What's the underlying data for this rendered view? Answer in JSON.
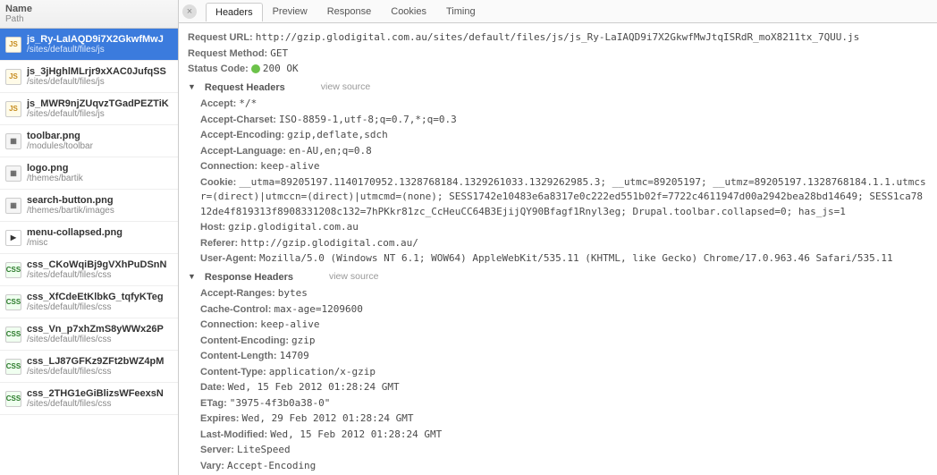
{
  "sidebar": {
    "header_name": "Name",
    "header_path": "Path",
    "items": [
      {
        "icon": "js",
        "name": "js_Ry-LaIAQD9i7X2GkwfMwJ",
        "path": "/sites/default/files/js",
        "selected": true
      },
      {
        "icon": "js",
        "name": "js_3jHghlMLrjr9xXAC0JufqSS",
        "path": "/sites/default/files/js"
      },
      {
        "icon": "js",
        "name": "js_MWR9njZUqvzTGadPEZTiK",
        "path": "/sites/default/files/js"
      },
      {
        "icon": "img",
        "name": "toolbar.png",
        "path": "/modules/toolbar"
      },
      {
        "icon": "img",
        "name": "logo.png",
        "path": "/themes/bartik"
      },
      {
        "icon": "img",
        "name": "search-button.png",
        "path": "/themes/bartik/images"
      },
      {
        "icon": "play",
        "name": "menu-collapsed.png",
        "path": "/misc"
      },
      {
        "icon": "css",
        "name": "css_CKoWqiBj9gVXhPuDSnN",
        "path": "/sites/default/files/css"
      },
      {
        "icon": "css",
        "name": "css_XfCdeEtKlbkG_tqfyKTeg",
        "path": "/sites/default/files/css"
      },
      {
        "icon": "css",
        "name": "css_Vn_p7xhZmS8yWWx26P",
        "path": "/sites/default/files/css"
      },
      {
        "icon": "css",
        "name": "css_LJ87GFKz9ZFt2bWZ4pM",
        "path": "/sites/default/files/css"
      },
      {
        "icon": "css",
        "name": "css_2THG1eGiBlizsWFeexsN",
        "path": "/sites/default/files/css"
      }
    ]
  },
  "tabs": [
    "Headers",
    "Preview",
    "Response",
    "Cookies",
    "Timing"
  ],
  "active_tab": 0,
  "general": {
    "request_url_label": "Request URL:",
    "request_url": "http://gzip.glodigital.com.au/sites/default/files/js/js_Ry-LaIAQD9i7X2GkwfMwJtqISRdR_moX8211tx_7QUU.js",
    "request_method_label": "Request Method:",
    "request_method": "GET",
    "status_code_label": "Status Code:",
    "status_code": "200 OK"
  },
  "request_headers_title": "Request Headers",
  "response_headers_title": "Response Headers",
  "view_source_label": "view source",
  "request_headers": [
    {
      "k": "Accept:",
      "v": "*/*"
    },
    {
      "k": "Accept-Charset:",
      "v": "ISO-8859-1,utf-8;q=0.7,*;q=0.3"
    },
    {
      "k": "Accept-Encoding:",
      "v": "gzip,deflate,sdch"
    },
    {
      "k": "Accept-Language:",
      "v": "en-AU,en;q=0.8"
    },
    {
      "k": "Connection:",
      "v": "keep-alive"
    },
    {
      "k": "Cookie:",
      "v": "__utma=89205197.1140170952.1328768184.1329261033.1329262985.3; __utmc=89205197; __utmz=89205197.1328768184.1.1.utmcsr=(direct)|utmccn=(direct)|utmcmd=(none); SESS1742e10483e6a8317e0c222ed551b02f=7722c4611947d00a2942bea28bd14649; SESS1ca7812de4f819313f8908331208c132=7hPKkr81zc_CcHeuCC64B3EjijQY90Bfagf1Rnyl3eg; Drupal.toolbar.collapsed=0; has_js=1"
    },
    {
      "k": "Host:",
      "v": "gzip.glodigital.com.au"
    },
    {
      "k": "Referer:",
      "v": "http://gzip.glodigital.com.au/"
    },
    {
      "k": "User-Agent:",
      "v": "Mozilla/5.0 (Windows NT 6.1; WOW64) AppleWebKit/535.11 (KHTML, like Gecko) Chrome/17.0.963.46 Safari/535.11"
    }
  ],
  "response_headers": [
    {
      "k": "Accept-Ranges:",
      "v": "bytes"
    },
    {
      "k": "Cache-Control:",
      "v": "max-age=1209600"
    },
    {
      "k": "Connection:",
      "v": "keep-alive"
    },
    {
      "k": "Content-Encoding:",
      "v": "gzip"
    },
    {
      "k": "Content-Length:",
      "v": "14709"
    },
    {
      "k": "Content-Type:",
      "v": "application/x-gzip"
    },
    {
      "k": "Date:",
      "v": "Wed, 15 Feb 2012 01:28:24 GMT"
    },
    {
      "k": "ETag:",
      "v": "\"3975-4f3b0a38-0\""
    },
    {
      "k": "Expires:",
      "v": "Wed, 29 Feb 2012 01:28:24 GMT"
    },
    {
      "k": "Last-Modified:",
      "v": "Wed, 15 Feb 2012 01:28:24 GMT"
    },
    {
      "k": "Server:",
      "v": "LiteSpeed"
    },
    {
      "k": "Vary:",
      "v": "Accept-Encoding"
    }
  ]
}
